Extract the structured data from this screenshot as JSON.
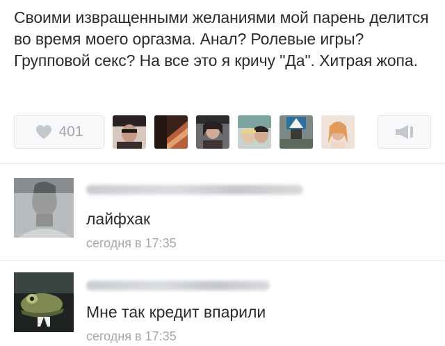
{
  "post": {
    "text": "Своими извращенными желаниями мой парень делится во время моего оргазма. Анал? Ролевые игры? Групповой секс? На все это я кричу \"Да\". Хитрая жопа.",
    "likes": {
      "count": "401",
      "icon": "heart-icon"
    },
    "likers_count": 6,
    "share_icon": "megaphone-icon"
  },
  "comments": [
    {
      "text": "лайфхак",
      "time": "сегодня в 17:35"
    },
    {
      "text": "Мне так кредит впарили",
      "time": "сегодня в 17:35"
    }
  ],
  "colors": {
    "text": "#2b2b2b",
    "muted": "#a3a7ad",
    "divider": "#e6e8eb",
    "button_bg": "#f7f8fa"
  }
}
